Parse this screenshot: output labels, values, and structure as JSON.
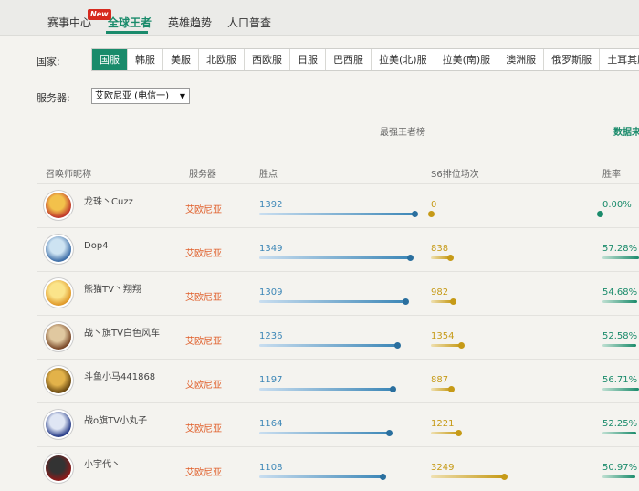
{
  "nav": {
    "tabs": [
      "赛事中心",
      "全球王者",
      "英雄趋势",
      "人口普查"
    ],
    "active": 1,
    "new_badge": "New"
  },
  "filters": {
    "country_label": "国家:",
    "countries": [
      "国服",
      "韩服",
      "美服",
      "北欧服",
      "西欧服",
      "日服",
      "巴西服",
      "拉美(北)服",
      "拉美(南)服",
      "澳洲服",
      "俄罗斯服",
      "土耳其服"
    ],
    "active_country": 0,
    "server_label": "服务器:",
    "server_value": "艾欧尼亚 (电信一)"
  },
  "ranking": {
    "title": "最强王者榜",
    "data_source": "数据来",
    "columns": {
      "name": "召唤师昵称",
      "server": "服务器",
      "lp": "胜点",
      "games": "S6排位场次",
      "winrate": "胜率"
    },
    "rows": [
      {
        "name": "龙珠丶Cuzz",
        "server": "艾欧尼亚",
        "lp": 1392,
        "games": 0,
        "winrate": "0.00%",
        "wr": 0.0,
        "avatar": [
          "#c0392b",
          "#f3c14b"
        ]
      },
      {
        "name": "Dop4",
        "server": "艾欧尼亚",
        "lp": 1349,
        "games": 838,
        "winrate": "57.28%",
        "wr": 57.28,
        "avatar": [
          "#3f6fa8",
          "#cde3f2"
        ]
      },
      {
        "name": "熊猫TV丶翔翔",
        "server": "艾欧尼亚",
        "lp": 1309,
        "games": 982,
        "winrate": "54.68%",
        "wr": 54.68,
        "avatar": [
          "#e09a2a",
          "#fbe48a"
        ]
      },
      {
        "name": "战丶旗TV白色风车",
        "server": "艾欧尼亚",
        "lp": 1236,
        "games": 1354,
        "winrate": "52.58%",
        "wr": 52.58,
        "avatar": [
          "#7b4a2a",
          "#e0c8a0"
        ]
      },
      {
        "name": "斗鱼小马441868",
        "server": "艾欧尼亚",
        "lp": 1197,
        "games": 887,
        "winrate": "56.71%",
        "wr": 56.71,
        "avatar": [
          "#6b4a12",
          "#e2b24a"
        ]
      },
      {
        "name": "战o旗TV小丸子",
        "server": "艾欧尼亚",
        "lp": 1164,
        "games": 1221,
        "winrate": "52.25%",
        "wr": 52.25,
        "avatar": [
          "#2a3f8a",
          "#dfe6f4"
        ]
      },
      {
        "name": "小宇代丶",
        "server": "艾欧尼亚",
        "lp": 1108,
        "games": 3249,
        "winrate": "50.97%",
        "wr": 50.97,
        "avatar": [
          "#8a1a1a",
          "#333333"
        ]
      }
    ],
    "colors": {
      "lp": "#3d87b7",
      "games": "#c69a17",
      "winrate": "#1a8b6b"
    }
  }
}
